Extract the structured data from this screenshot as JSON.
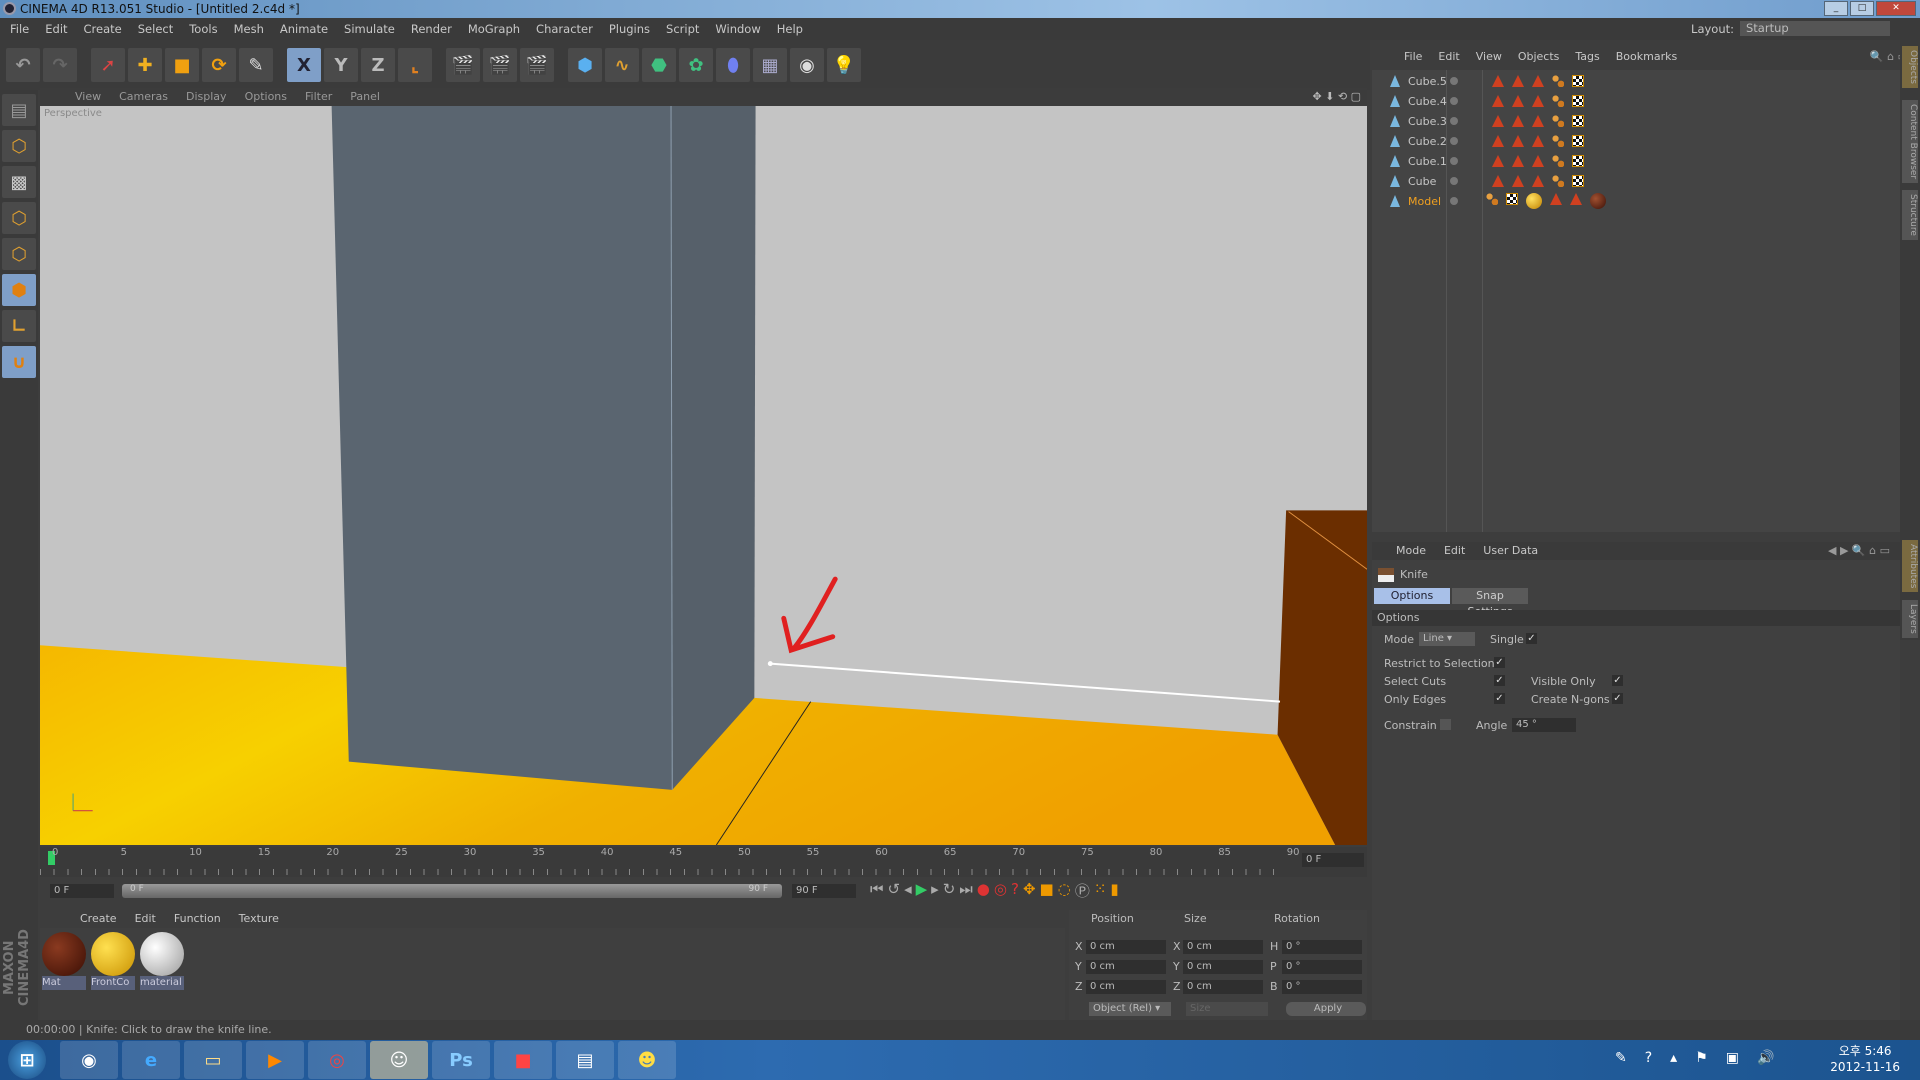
{
  "title": "CINEMA 4D R13.051 Studio - [Untitled 2.c4d *]",
  "menu": [
    "File",
    "Edit",
    "Create",
    "Select",
    "Tools",
    "Mesh",
    "Animate",
    "Simulate",
    "Render",
    "MoGraph",
    "Character",
    "Plugins",
    "Script",
    "Window",
    "Help"
  ],
  "layout": {
    "label": "Layout:",
    "value": "Startup"
  },
  "toolbar": {
    "x_label": "X",
    "y_label": "Y",
    "z_label": "Z"
  },
  "viewport": {
    "menu": [
      "View",
      "Cameras",
      "Display",
      "Options",
      "Filter",
      "Panel"
    ],
    "label": "Perspective",
    "colors": {
      "wall": "#c4c4c4",
      "floor": "#f2b400",
      "pillar": "#5a6570",
      "box": "#6b2e00",
      "arrow": "#e02020"
    }
  },
  "object_manager": {
    "menu": [
      "File",
      "Edit",
      "View",
      "Objects",
      "Tags",
      "Bookmarks"
    ],
    "objects": [
      {
        "name": "Cube.5",
        "selected": false
      },
      {
        "name": "Cube.4",
        "selected": false
      },
      {
        "name": "Cube.3",
        "selected": false
      },
      {
        "name": "Cube.2",
        "selected": false
      },
      {
        "name": "Cube.1",
        "selected": false
      },
      {
        "name": "Cube",
        "selected": false
      },
      {
        "name": "Model",
        "selected": true
      }
    ]
  },
  "side_tabs": [
    "Objects",
    "Content Browser",
    "Structure",
    "Attributes",
    "Layers"
  ],
  "attributes": {
    "menu": [
      "Mode",
      "Edit",
      "User Data"
    ],
    "tool_name": "Knife",
    "tabs": [
      "Options",
      "Snap Settings"
    ],
    "section": "Options",
    "mode_label": "Mode",
    "mode_value": "Line",
    "single_label": "Single",
    "single": true,
    "restrict_label": "Restrict to Selection",
    "restrict": true,
    "select_cuts_label": "Select Cuts",
    "select_cuts": true,
    "visible_only_label": "Visible Only",
    "visible_only": true,
    "only_edges_label": "Only Edges",
    "only_edges": true,
    "create_ngons_label": "Create N-gons",
    "create_ngons": true,
    "constrain_label": "Constrain",
    "constrain": false,
    "angle_label": "Angle",
    "angle_value": "45 °"
  },
  "timeline": {
    "ticks": [
      "0",
      "5",
      "10",
      "15",
      "20",
      "25",
      "30",
      "35",
      "40",
      "45",
      "50",
      "55",
      "60",
      "65",
      "70",
      "75",
      "80",
      "85",
      "90"
    ],
    "current": "0 F",
    "start": "0 F",
    "range_start": "0 F",
    "range_end": "90 F",
    "end": "90 F"
  },
  "materials": {
    "menu": [
      "Create",
      "Edit",
      "Function",
      "Texture"
    ],
    "items": [
      {
        "name": "Mat",
        "color": "#5a1a0a"
      },
      {
        "name": "FrontCo",
        "color": "#e8b400"
      },
      {
        "name": "material",
        "color": "#e8e8e8"
      }
    ]
  },
  "coordinates": {
    "headers": [
      "Position",
      "Size",
      "Rotation"
    ],
    "rows": [
      {
        "a": "X",
        "p": "0 cm",
        "b": "X",
        "s": "0 cm",
        "c": "H",
        "r": "0 °"
      },
      {
        "a": "Y",
        "p": "0 cm",
        "b": "Y",
        "s": "0 cm",
        "c": "P",
        "r": "0 °"
      },
      {
        "a": "Z",
        "p": "0 cm",
        "b": "Z",
        "s": "0 cm",
        "c": "B",
        "r": "0 °"
      }
    ],
    "mode": "Object (Rel)",
    "size_mode": "Size",
    "apply": "Apply"
  },
  "brand": "MAXON CINEMA4D",
  "status": {
    "time": "00:00:00",
    "message": "Knife: Click to draw the knife line."
  },
  "taskbar": {
    "apps": [
      "Start",
      "Cinema 4D",
      "Internet Explorer",
      "Explorer",
      "Media Player",
      "Chrome",
      "Messenger",
      "Photoshop",
      "App",
      "Window",
      "Chat"
    ],
    "time": "오후 5:46",
    "date": "2012-11-16"
  }
}
